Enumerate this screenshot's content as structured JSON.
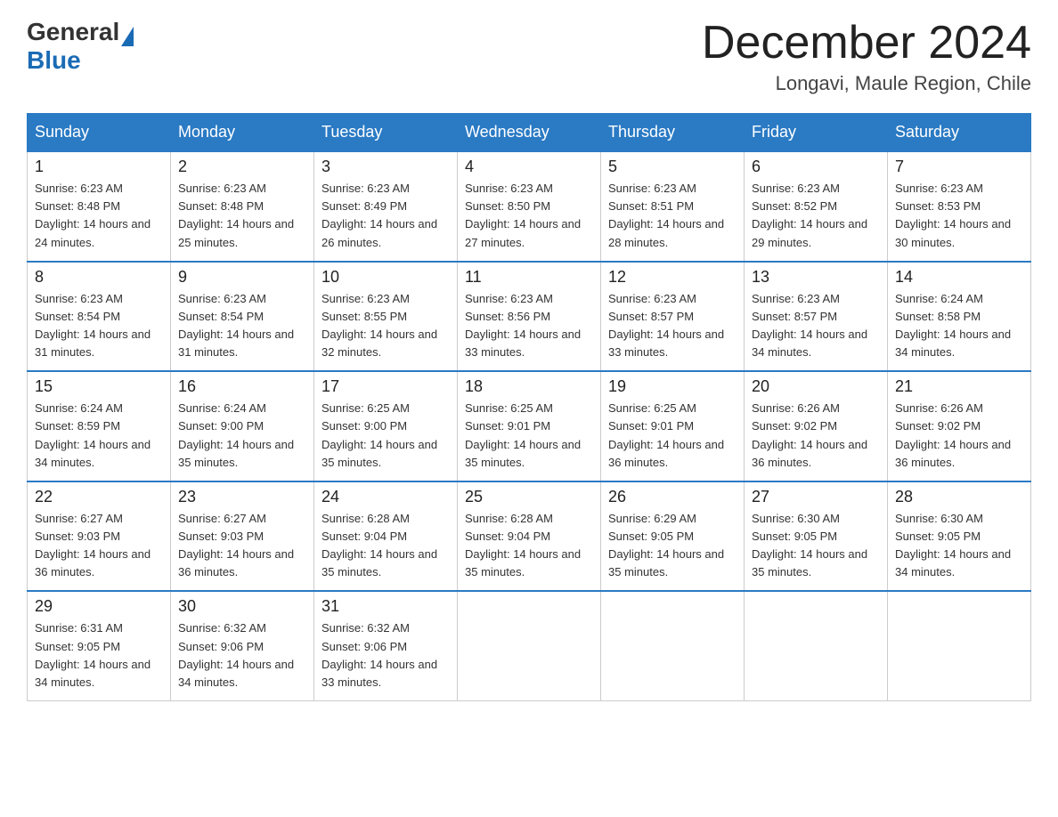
{
  "header": {
    "logo_general": "General",
    "logo_blue": "Blue",
    "month_title": "December 2024",
    "location": "Longavi, Maule Region, Chile"
  },
  "days_of_week": [
    "Sunday",
    "Monday",
    "Tuesday",
    "Wednesday",
    "Thursday",
    "Friday",
    "Saturday"
  ],
  "weeks": [
    [
      {
        "day": "1",
        "sunrise": "6:23 AM",
        "sunset": "8:48 PM",
        "daylight": "14 hours and 24 minutes."
      },
      {
        "day": "2",
        "sunrise": "6:23 AM",
        "sunset": "8:48 PM",
        "daylight": "14 hours and 25 minutes."
      },
      {
        "day": "3",
        "sunrise": "6:23 AM",
        "sunset": "8:49 PM",
        "daylight": "14 hours and 26 minutes."
      },
      {
        "day": "4",
        "sunrise": "6:23 AM",
        "sunset": "8:50 PM",
        "daylight": "14 hours and 27 minutes."
      },
      {
        "day": "5",
        "sunrise": "6:23 AM",
        "sunset": "8:51 PM",
        "daylight": "14 hours and 28 minutes."
      },
      {
        "day": "6",
        "sunrise": "6:23 AM",
        "sunset": "8:52 PM",
        "daylight": "14 hours and 29 minutes."
      },
      {
        "day": "7",
        "sunrise": "6:23 AM",
        "sunset": "8:53 PM",
        "daylight": "14 hours and 30 minutes."
      }
    ],
    [
      {
        "day": "8",
        "sunrise": "6:23 AM",
        "sunset": "8:54 PM",
        "daylight": "14 hours and 31 minutes."
      },
      {
        "day": "9",
        "sunrise": "6:23 AM",
        "sunset": "8:54 PM",
        "daylight": "14 hours and 31 minutes."
      },
      {
        "day": "10",
        "sunrise": "6:23 AM",
        "sunset": "8:55 PM",
        "daylight": "14 hours and 32 minutes."
      },
      {
        "day": "11",
        "sunrise": "6:23 AM",
        "sunset": "8:56 PM",
        "daylight": "14 hours and 33 minutes."
      },
      {
        "day": "12",
        "sunrise": "6:23 AM",
        "sunset": "8:57 PM",
        "daylight": "14 hours and 33 minutes."
      },
      {
        "day": "13",
        "sunrise": "6:23 AM",
        "sunset": "8:57 PM",
        "daylight": "14 hours and 34 minutes."
      },
      {
        "day": "14",
        "sunrise": "6:24 AM",
        "sunset": "8:58 PM",
        "daylight": "14 hours and 34 minutes."
      }
    ],
    [
      {
        "day": "15",
        "sunrise": "6:24 AM",
        "sunset": "8:59 PM",
        "daylight": "14 hours and 34 minutes."
      },
      {
        "day": "16",
        "sunrise": "6:24 AM",
        "sunset": "9:00 PM",
        "daylight": "14 hours and 35 minutes."
      },
      {
        "day": "17",
        "sunrise": "6:25 AM",
        "sunset": "9:00 PM",
        "daylight": "14 hours and 35 minutes."
      },
      {
        "day": "18",
        "sunrise": "6:25 AM",
        "sunset": "9:01 PM",
        "daylight": "14 hours and 35 minutes."
      },
      {
        "day": "19",
        "sunrise": "6:25 AM",
        "sunset": "9:01 PM",
        "daylight": "14 hours and 36 minutes."
      },
      {
        "day": "20",
        "sunrise": "6:26 AM",
        "sunset": "9:02 PM",
        "daylight": "14 hours and 36 minutes."
      },
      {
        "day": "21",
        "sunrise": "6:26 AM",
        "sunset": "9:02 PM",
        "daylight": "14 hours and 36 minutes."
      }
    ],
    [
      {
        "day": "22",
        "sunrise": "6:27 AM",
        "sunset": "9:03 PM",
        "daylight": "14 hours and 36 minutes."
      },
      {
        "day": "23",
        "sunrise": "6:27 AM",
        "sunset": "9:03 PM",
        "daylight": "14 hours and 36 minutes."
      },
      {
        "day": "24",
        "sunrise": "6:28 AM",
        "sunset": "9:04 PM",
        "daylight": "14 hours and 35 minutes."
      },
      {
        "day": "25",
        "sunrise": "6:28 AM",
        "sunset": "9:04 PM",
        "daylight": "14 hours and 35 minutes."
      },
      {
        "day": "26",
        "sunrise": "6:29 AM",
        "sunset": "9:05 PM",
        "daylight": "14 hours and 35 minutes."
      },
      {
        "day": "27",
        "sunrise": "6:30 AM",
        "sunset": "9:05 PM",
        "daylight": "14 hours and 35 minutes."
      },
      {
        "day": "28",
        "sunrise": "6:30 AM",
        "sunset": "9:05 PM",
        "daylight": "14 hours and 34 minutes."
      }
    ],
    [
      {
        "day": "29",
        "sunrise": "6:31 AM",
        "sunset": "9:05 PM",
        "daylight": "14 hours and 34 minutes."
      },
      {
        "day": "30",
        "sunrise": "6:32 AM",
        "sunset": "9:06 PM",
        "daylight": "14 hours and 34 minutes."
      },
      {
        "day": "31",
        "sunrise": "6:32 AM",
        "sunset": "9:06 PM",
        "daylight": "14 hours and 33 minutes."
      },
      null,
      null,
      null,
      null
    ]
  ],
  "labels": {
    "sunrise_prefix": "Sunrise: ",
    "sunset_prefix": "Sunset: ",
    "daylight_prefix": "Daylight: "
  }
}
